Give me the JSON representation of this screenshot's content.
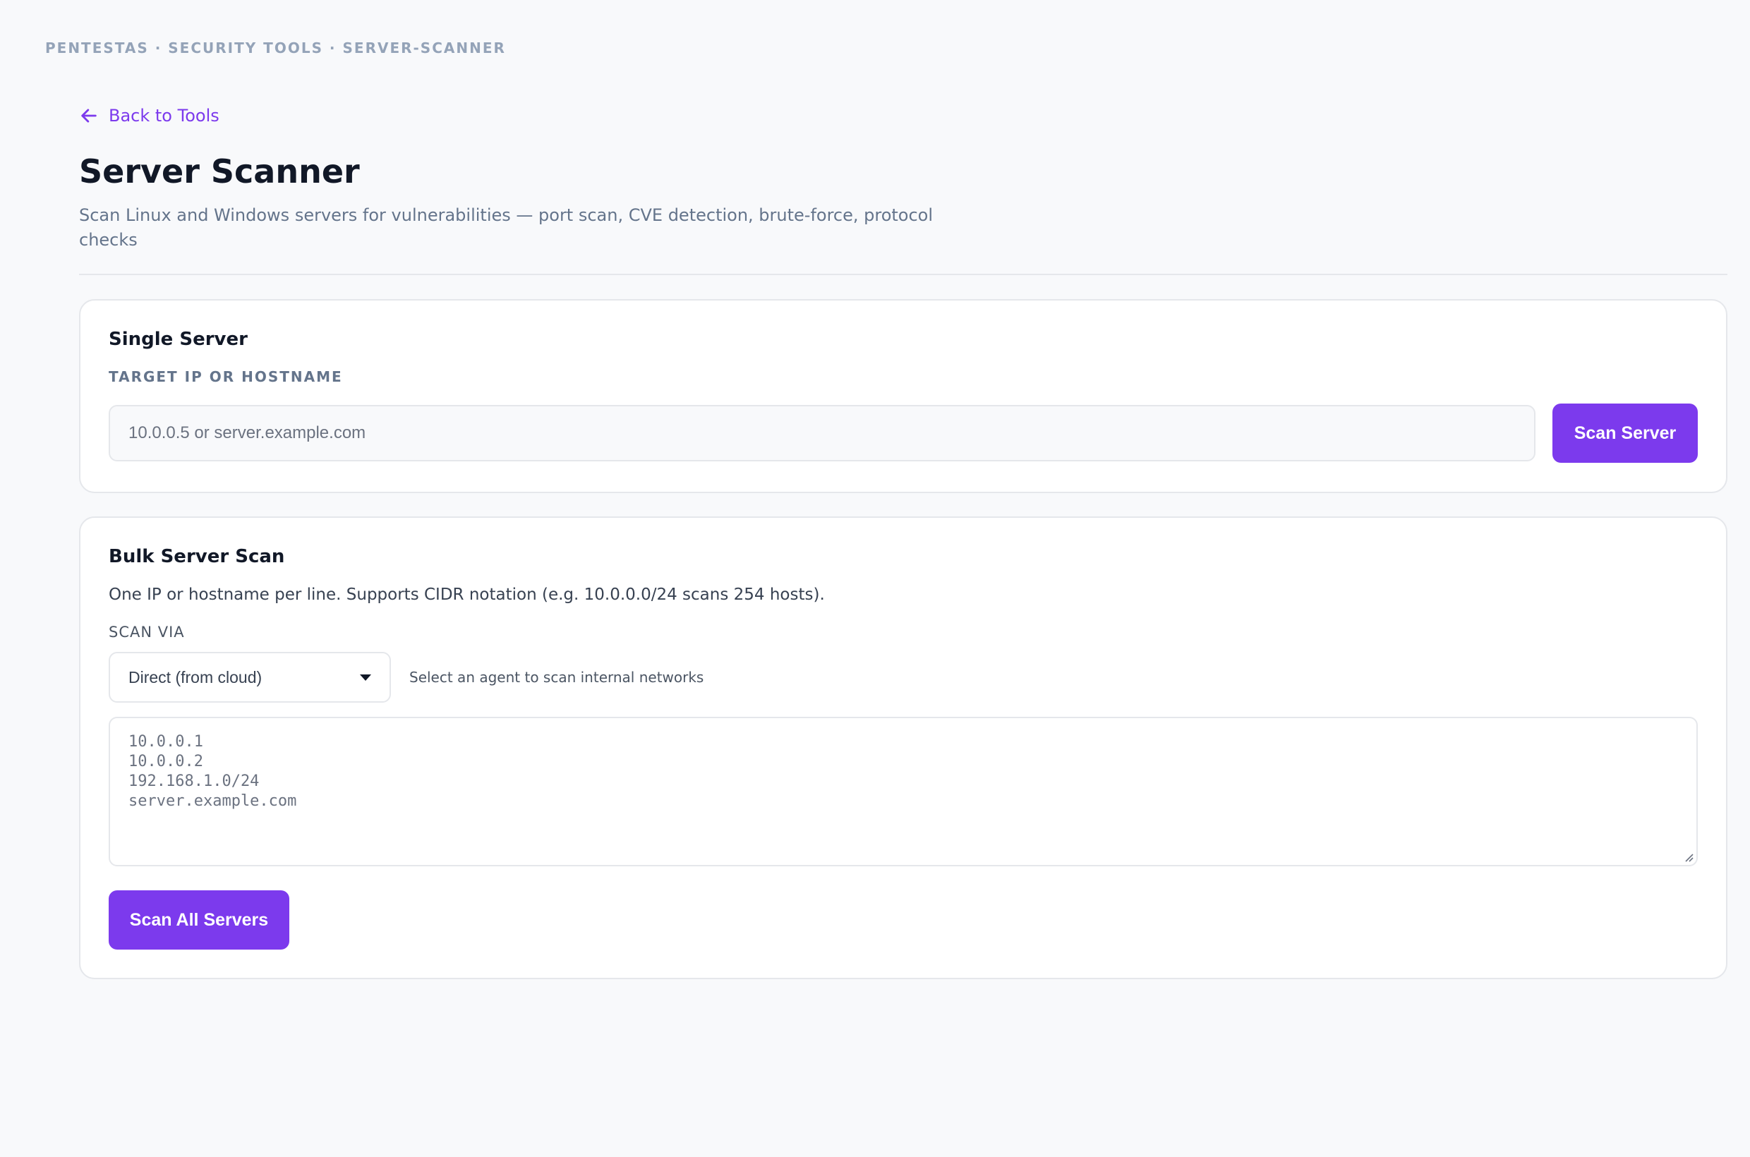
{
  "breadcrumb": "PENTESTAS · SECURITY TOOLS · SERVER-SCANNER",
  "back_link": "Back to Tools",
  "page_title": "Server Scanner",
  "page_subtitle": "Scan Linux and Windows servers for vulnerabilities — port scan, CVE detection, brute-force, protocol checks",
  "single": {
    "title": "Single Server",
    "label": "TARGET IP OR HOSTNAME",
    "placeholder": "10.0.0.5 or server.example.com",
    "button": "Scan Server"
  },
  "bulk": {
    "title": "Bulk Server Scan",
    "help": "One IP or hostname per line. Supports CIDR notation (e.g. 10.0.0.0/24 scans 254 hosts).",
    "via_label": "SCAN VIA",
    "via_selected": "Direct (from cloud)",
    "via_hint": "Select an agent to scan internal networks",
    "textarea_placeholder_lines": [
      "10.0.0.1",
      "10.0.0.2",
      "192.168.1.0/24",
      "server.example.com"
    ],
    "button": "Scan All Servers"
  },
  "colors": {
    "accent": "#7c3aed",
    "background": "#f8f9fb",
    "card": "#ffffff",
    "border": "#e5e7eb"
  },
  "icons": {
    "back": "arrow-left-icon",
    "select": "caret-down-icon",
    "resize": "resize-grip-icon"
  }
}
